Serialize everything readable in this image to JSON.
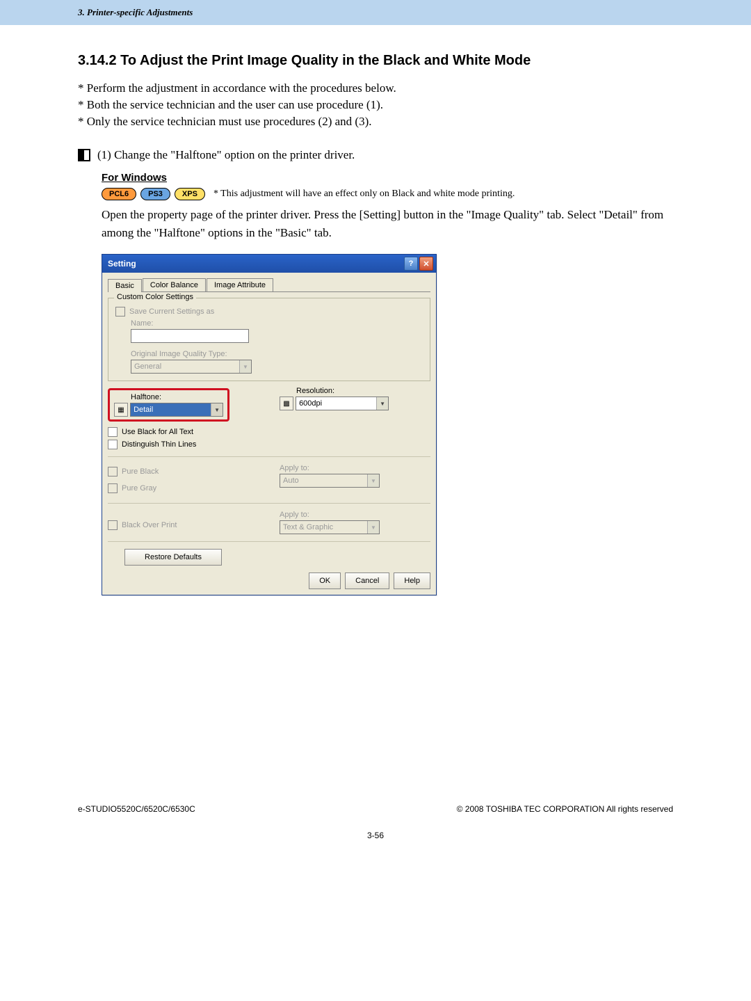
{
  "header": {
    "breadcrumb": "3. Printer-specific Adjustments"
  },
  "section": {
    "number_title": "3.14.2  To Adjust the Print Image Quality in the Black and White Mode",
    "notes": [
      "* Perform the adjustment in accordance with the procedures below.",
      "* Both the service technician and the user can use procedure (1).",
      "* Only the service technician must use procedures (2) and (3)."
    ],
    "step1": "(1)  Change the \"Halftone\" option on the printer driver."
  },
  "windows": {
    "title": "For Windows",
    "badges": {
      "pcl6": "PCL6",
      "ps3": "PS3",
      "xps": "XPS"
    },
    "badge_note": "* This adjustment will have an effect only on Black and white mode printing.",
    "instructions": "Open the property page of the printer driver.  Press the [Setting] button in the \"Image Quality\" tab.  Select \"Detail\" from among the \"Halftone\" options in the \"Basic\" tab."
  },
  "dialog": {
    "title": "Setting",
    "tabs": {
      "basic": "Basic",
      "color_balance": "Color Balance",
      "image_attribute": "Image Attribute"
    },
    "group": {
      "title": "Custom Color Settings",
      "save_as": "Save Current Settings as",
      "name_label": "Name:",
      "oiq_label": "Original Image Quality Type:",
      "oiq_value": "General"
    },
    "halftone": {
      "label": "Halftone:",
      "value": "Detail",
      "resolution_label": "Resolution:",
      "resolution_value": "600dpi"
    },
    "checks": {
      "use_black": "Use Black for All Text",
      "distinguish": "Distinguish Thin Lines",
      "pure_black": "Pure Black",
      "pure_gray": "Pure Gray",
      "apply_to_label": "Apply to:",
      "apply_to_value1": "Auto",
      "black_overprint": "Black Over Print",
      "apply_to_value2": "Text & Graphic"
    },
    "buttons": {
      "restore": "Restore Defaults",
      "ok": "OK",
      "cancel": "Cancel",
      "help": "Help"
    }
  },
  "footer": {
    "left": "e-STUDIO5520C/6520C/6530C",
    "right": "© 2008 TOSHIBA TEC CORPORATION All rights reserved",
    "page": "3-56"
  }
}
